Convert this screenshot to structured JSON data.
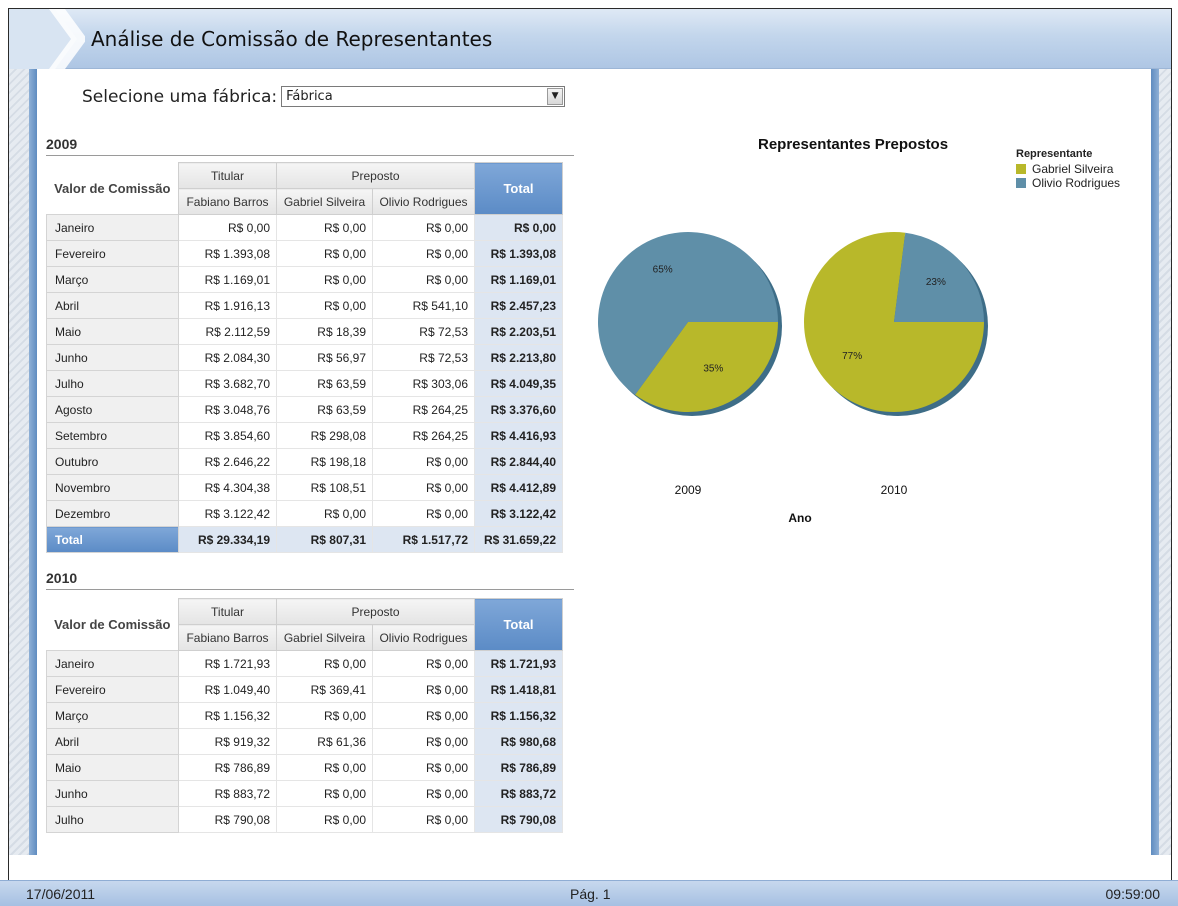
{
  "header": {
    "title": "Análise de Comissão de Representantes"
  },
  "selector": {
    "label": "Selecione uma fábrica:",
    "value": "Fábrica"
  },
  "table_headers": {
    "corner": "Valor de Comissão",
    "titular": "Titular",
    "preposto": "Preposto",
    "fabiano": "Fabiano Barros",
    "gabriel": "Gabriel Silveira",
    "olivio": "Olivio Rodrigues",
    "total": "Total"
  },
  "tables": [
    {
      "year": "2009",
      "rows": [
        [
          "Janeiro",
          "R$ 0,00",
          "R$ 0,00",
          "R$ 0,00",
          "R$ 0,00"
        ],
        [
          "Fevereiro",
          "R$ 1.393,08",
          "R$ 0,00",
          "R$ 0,00",
          "R$ 1.393,08"
        ],
        [
          "Março",
          "R$ 1.169,01",
          "R$ 0,00",
          "R$ 0,00",
          "R$ 1.169,01"
        ],
        [
          "Abril",
          "R$ 1.916,13",
          "R$ 0,00",
          "R$ 541,10",
          "R$ 2.457,23"
        ],
        [
          "Maio",
          "R$ 2.112,59",
          "R$ 18,39",
          "R$ 72,53",
          "R$ 2.203,51"
        ],
        [
          "Junho",
          "R$ 2.084,30",
          "R$ 56,97",
          "R$ 72,53",
          "R$ 2.213,80"
        ],
        [
          "Julho",
          "R$ 3.682,70",
          "R$ 63,59",
          "R$ 303,06",
          "R$ 4.049,35"
        ],
        [
          "Agosto",
          "R$ 3.048,76",
          "R$ 63,59",
          "R$ 264,25",
          "R$ 3.376,60"
        ],
        [
          "Setembro",
          "R$ 3.854,60",
          "R$ 298,08",
          "R$ 264,25",
          "R$ 4.416,93"
        ],
        [
          "Outubro",
          "R$ 2.646,22",
          "R$ 198,18",
          "R$ 0,00",
          "R$ 2.844,40"
        ],
        [
          "Novembro",
          "R$ 4.304,38",
          "R$ 108,51",
          "R$ 0,00",
          "R$ 4.412,89"
        ],
        [
          "Dezembro",
          "R$ 3.122,42",
          "R$ 0,00",
          "R$ 0,00",
          "R$ 3.122,42"
        ]
      ],
      "total_row": [
        "Total",
        "R$ 29.334,19",
        "R$ 807,31",
        "R$ 1.517,72",
        "R$ 31.659,22"
      ]
    },
    {
      "year": "2010",
      "rows": [
        [
          "Janeiro",
          "R$ 1.721,93",
          "R$ 0,00",
          "R$ 0,00",
          "R$ 1.721,93"
        ],
        [
          "Fevereiro",
          "R$ 1.049,40",
          "R$ 369,41",
          "R$ 0,00",
          "R$ 1.418,81"
        ],
        [
          "Março",
          "R$ 1.156,32",
          "R$ 0,00",
          "R$ 0,00",
          "R$ 1.156,32"
        ],
        [
          "Abril",
          "R$ 919,32",
          "R$ 61,36",
          "R$ 0,00",
          "R$ 980,68"
        ],
        [
          "Maio",
          "R$ 786,89",
          "R$ 0,00",
          "R$ 0,00",
          "R$ 786,89"
        ],
        [
          "Junho",
          "R$ 883,72",
          "R$ 0,00",
          "R$ 0,00",
          "R$ 883,72"
        ],
        [
          "Julho",
          "R$ 790,08",
          "R$ 0,00",
          "R$ 0,00",
          "R$ 790,08"
        ]
      ]
    }
  ],
  "chart_data": {
    "type": "pie",
    "title": "Representantes Prepostos",
    "legend_title": "Representante",
    "legend_position": "top-right",
    "xlabel": "Ano",
    "series": [
      {
        "name": "Gabriel Silveira",
        "color": "#b8b82a"
      },
      {
        "name": "Olivio Rodrigues",
        "color": "#5f8fa8"
      }
    ],
    "pies": [
      {
        "category": "2009",
        "values": [
          35,
          65
        ],
        "labels": [
          "35%",
          "65%"
        ]
      },
      {
        "category": "2010",
        "values": [
          77,
          23
        ],
        "labels": [
          "77%",
          "23%"
        ]
      }
    ]
  },
  "footer": {
    "date": "17/06/2011",
    "page": "Pág. 1",
    "time": "09:59:00"
  },
  "colors": {
    "accent": "#5b8bc6",
    "header_band": "#c3d6ec"
  }
}
